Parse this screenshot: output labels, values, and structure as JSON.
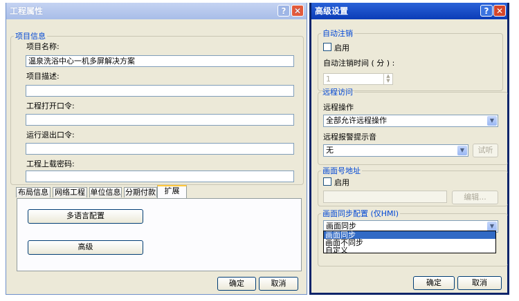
{
  "left_window": {
    "title": "工程属性",
    "help_glyph": "?",
    "close_glyph": "✕",
    "group_title": "项目信息",
    "project_name_label": "项目名称:",
    "project_name_value": "温泉洗浴中心一机多屏解决方案",
    "project_desc_label": "项目描述:",
    "project_desc_value": "",
    "open_pwd_label": "工程打开口令:",
    "open_pwd_value": "",
    "exit_pwd_label": "运行退出口令:",
    "exit_pwd_value": "",
    "upload_pwd_label": "工程上载密码:",
    "upload_pwd_value": "",
    "tabs": [
      "布局信息",
      "网络工程",
      "单位信息",
      "分期付款",
      "扩展"
    ],
    "active_tab": 4,
    "multilang_button": "多语言配置",
    "advanced_button": "高级",
    "ok_button": "确定",
    "cancel_button": "取消"
  },
  "right_window": {
    "title": "高级设置",
    "help_glyph": "?",
    "close_glyph": "✕",
    "autologout": {
      "title": "自动注销",
      "enable_label": "启用",
      "enabled": false,
      "time_label": "自动注销时间 ( 分 ) :",
      "time_value": "1"
    },
    "remote": {
      "title": "远程访问",
      "op_label": "远程操作",
      "op_value": "全部允许远程操作",
      "alarm_label": "远程报警提示音",
      "alarm_value": "无",
      "test_button": "试听"
    },
    "screen_addr": {
      "title": "画面号地址",
      "enable_label": "启用",
      "enabled": false,
      "address_value": "",
      "edit_button": "编辑..."
    },
    "sync": {
      "title": "画面同步配置 (仅HMI)",
      "selected": "画面同步",
      "options": [
        "画面同步",
        "画面不同步",
        "自定义"
      ],
      "highlighted": 0
    },
    "ok_button": "确定",
    "cancel_button": "取消"
  },
  "colors": {
    "dialog_bg": "#ece9d8",
    "active_title": "#0b3cb7",
    "inactive_title": "#a8bde8",
    "group_title": "#0046d5",
    "selection": "#316ac5"
  }
}
